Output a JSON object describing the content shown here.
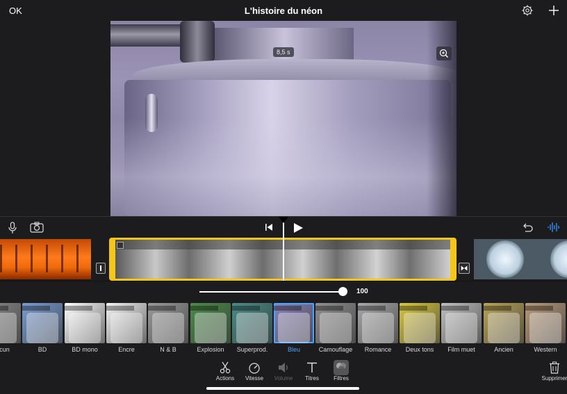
{
  "header": {
    "ok_label": "OK",
    "title": "L'histoire du néon",
    "settings_icon": "gear-icon",
    "add_icon": "plus-icon"
  },
  "viewer": {
    "time_badge": "8,5 s",
    "zoom_icon": "zoom-in-icon"
  },
  "controls": {
    "mic_icon": "microphone-icon",
    "camera_icon": "camera-icon",
    "skip_back_icon": "skip-to-start-icon",
    "play_icon": "play-icon",
    "undo_icon": "undo-icon",
    "audio_icon": "waveform-icon"
  },
  "slider": {
    "value": "100",
    "level_fraction": 1.0
  },
  "filters": {
    "selected": "Bleu",
    "items": [
      {
        "label": "Aucun",
        "tint": "#8a8a8a"
      },
      {
        "label": "BD",
        "tint": "#7a9bd0"
      },
      {
        "label": "BD mono",
        "tint": "#ffffff"
      },
      {
        "label": "Encre",
        "tint": "#f4f4f4"
      },
      {
        "label": "N & B",
        "tint": "#9a9a9a"
      },
      {
        "label": "Explosion",
        "tint": "#4c8a4a"
      },
      {
        "label": "Superprod.",
        "tint": "#4a8a86"
      },
      {
        "label": "Bleu",
        "tint": "#8a83b8"
      },
      {
        "label": "Camouflage",
        "tint": "#8f8f8f"
      },
      {
        "label": "Romance",
        "tint": "#a8a8a8"
      },
      {
        "label": "Deux tons",
        "tint": "#d8c640"
      },
      {
        "label": "Film muet",
        "tint": "#c0c0c0"
      },
      {
        "label": "Ancien",
        "tint": "#b8a35a"
      },
      {
        "label": "Western",
        "tint": "#b89a7a"
      }
    ]
  },
  "toolbar": {
    "actions_label": "Actions",
    "speed_label": "Vitesse",
    "volume_label": "Volume",
    "titles_label": "Titres",
    "filters_label": "Filtres",
    "delete_label": "Supprimer"
  }
}
